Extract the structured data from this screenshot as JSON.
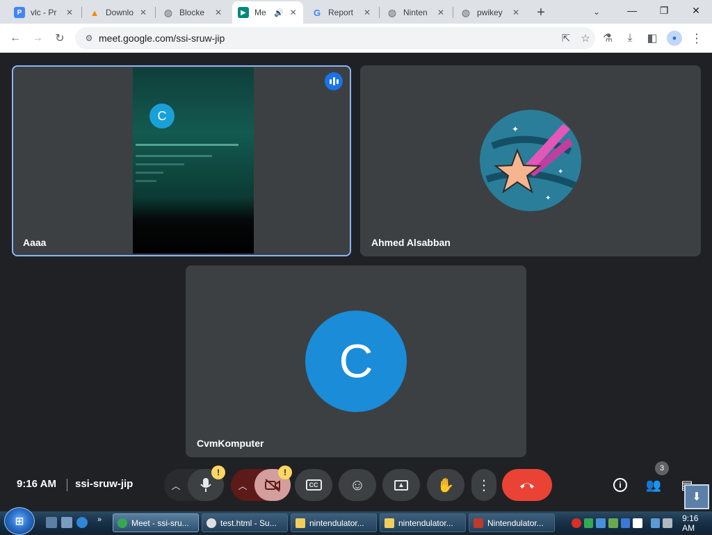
{
  "browser": {
    "tabs": [
      {
        "title": "vlc - Pr",
        "icon": "docs-icon",
        "color": "#4285f4",
        "glyph": "P"
      },
      {
        "title": "Downlo",
        "icon": "vlc-cone-icon",
        "color": "#f28b00",
        "glyph": "▲"
      },
      {
        "title": "Blocke",
        "icon": "globe-icon",
        "color": "#5f6368",
        "glyph": "◍"
      },
      {
        "title": "Me",
        "icon": "meet-icon",
        "color": "#00897b",
        "glyph": "▶",
        "active": true,
        "audio": "🔊"
      },
      {
        "title": "Report",
        "icon": "google-icon",
        "color": "#ffffff",
        "glyph": "G"
      },
      {
        "title": "Ninten",
        "icon": "globe-icon",
        "color": "#5f6368",
        "glyph": "◍"
      },
      {
        "title": "pwikey",
        "icon": "globe-icon",
        "color": "#5f6368",
        "glyph": "◍"
      }
    ],
    "url": "meet.google.com/ssi-sruw-jip"
  },
  "meet": {
    "participants": [
      {
        "name": "Aaaa",
        "video_avatar_letter": "C",
        "speaking": true
      },
      {
        "name": "Ahmed Alsabban",
        "avatar": "shooting-star-avatar"
      },
      {
        "name": "CvmKomputer",
        "avatar_letter": "C",
        "avatar_color": "#1a8cd8"
      }
    ],
    "time": "9:16 AM",
    "meeting_code": "ssi-sruw-jip",
    "people_count": "3",
    "warning_glyph": "!"
  },
  "taskbar": {
    "items": [
      {
        "label": "Meet - ssi-sru...",
        "color": "#34a853",
        "active": true
      },
      {
        "label": "test.html - Su...",
        "color": "#e0e0e0"
      },
      {
        "label": "nintendulator...",
        "color": "#f2cf5b"
      },
      {
        "label": "nintendulator...",
        "color": "#f2cf5b"
      },
      {
        "label": "Nintendulator...",
        "color": "#c0392b"
      }
    ],
    "clock": "9:16 AM",
    "start_glyph": "⊞"
  },
  "colors": {
    "accent": "#1a73e8",
    "end_call": "#ea4335",
    "mic_off": "#f28b82",
    "cam_off": "#e6a3a3",
    "tile_bg": "#3c4043",
    "page_bg": "#202124"
  }
}
